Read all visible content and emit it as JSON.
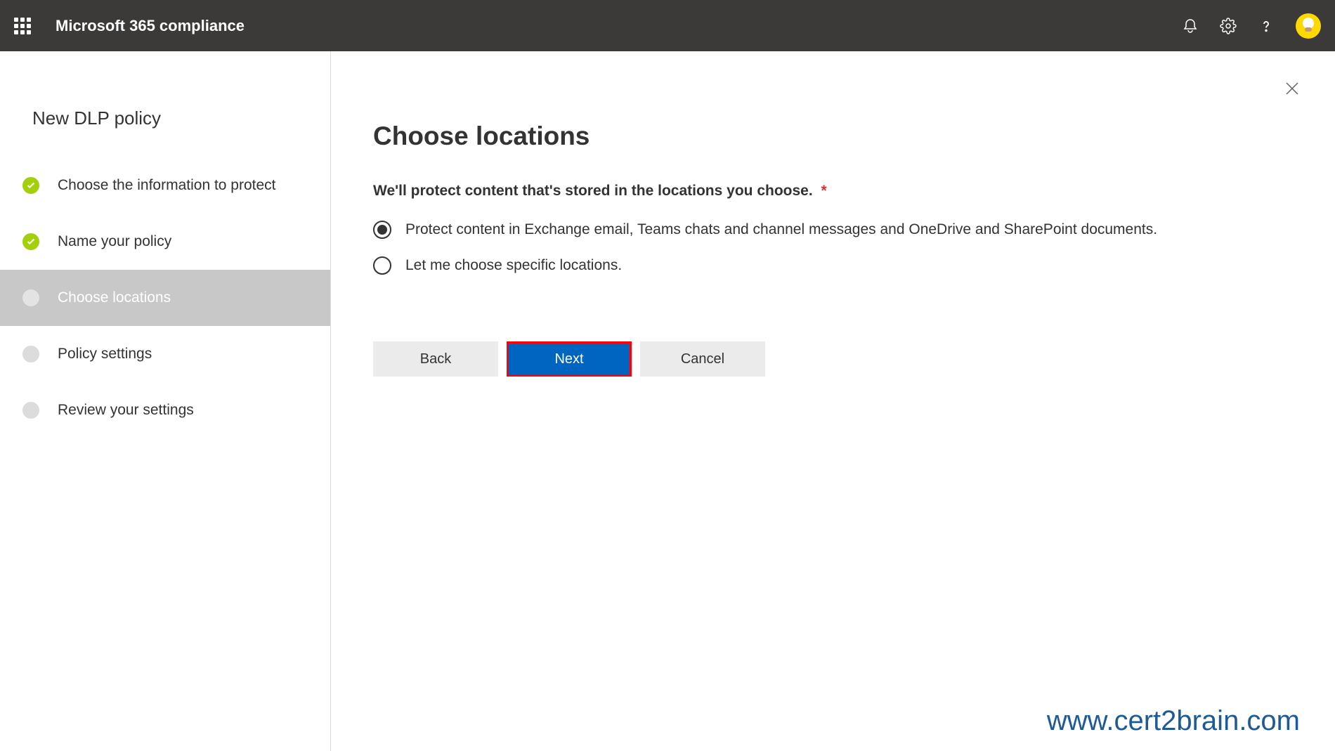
{
  "header": {
    "app_title": "Microsoft 365 compliance"
  },
  "sidebar": {
    "title": "New DLP policy",
    "steps": [
      {
        "label": "Choose the information to protect",
        "state": "complete"
      },
      {
        "label": "Name your policy",
        "state": "complete"
      },
      {
        "label": "Choose locations",
        "state": "current"
      },
      {
        "label": "Policy settings",
        "state": "pending"
      },
      {
        "label": "Review your settings",
        "state": "pending"
      }
    ]
  },
  "main": {
    "title": "Choose locations",
    "subtitle": "We'll protect content that's stored in the locations you choose.",
    "required_mark": "*",
    "options": [
      {
        "label": "Protect content in Exchange email, Teams chats and channel messages and OneDrive and SharePoint documents.",
        "selected": true
      },
      {
        "label": "Let me choose specific locations.",
        "selected": false
      }
    ],
    "buttons": {
      "back": "Back",
      "next": "Next",
      "cancel": "Cancel"
    }
  },
  "watermark": "www.cert2brain.com"
}
